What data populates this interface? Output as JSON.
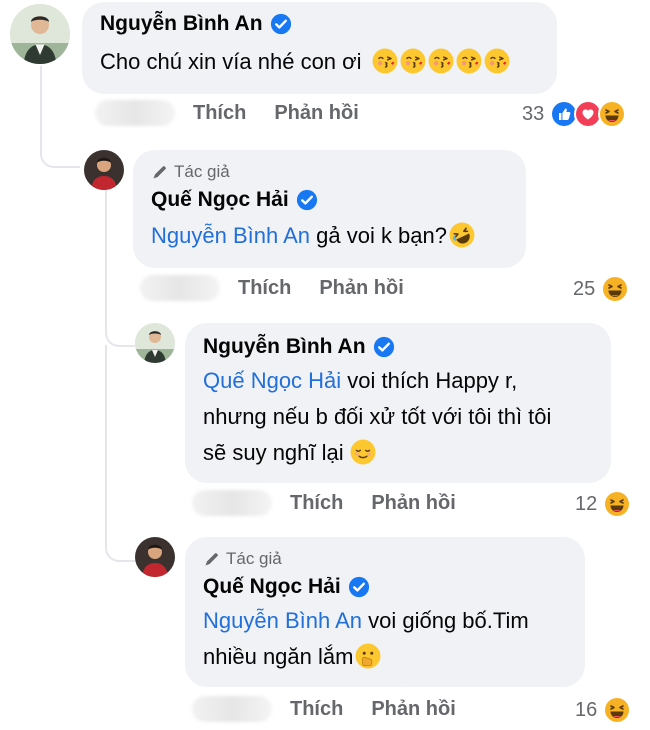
{
  "colors": {
    "bubble_bg": "#f0f2f5",
    "mention": "#216fdb",
    "verified": "#1877f2",
    "meta_text": "#65676b"
  },
  "comments": [
    {
      "name": "Nguyễn Bình An",
      "verified": true,
      "author_badge": "",
      "text": "Cho chú xin vía nhé con ơi",
      "emojis": [
        "kiss-face",
        "kiss-face",
        "kiss-face",
        "kiss-face",
        "kiss-face"
      ],
      "like_label": "Thích",
      "reply_label": "Phản hồi",
      "reaction_count": "33",
      "reactions": [
        "like",
        "love",
        "haha"
      ]
    },
    {
      "name": "Quế Ngọc Hải",
      "verified": true,
      "author_badge": "Tác giả",
      "mention": "Nguyễn Bình An",
      "text": " gả voi k bạn?",
      "emojis": [
        "rofl-face"
      ],
      "like_label": "Thích",
      "reply_label": "Phản hồi",
      "reaction_count": "25",
      "reactions": [
        "haha"
      ]
    },
    {
      "name": "Nguyễn Bình An",
      "verified": true,
      "mention": "Quế Ngọc Hải",
      "text_line1": " voi thích Happy r,",
      "text_line2": "nhưng nếu b đối xử tốt với tôi thì tôi",
      "text_line3": "sẽ suy nghĩ lại",
      "emojis": [
        "relieved-face"
      ],
      "like_label": "Thích",
      "reply_label": "Phản hồi",
      "reaction_count": "12",
      "reactions": [
        "haha"
      ]
    },
    {
      "name": "Quế Ngọc Hải",
      "verified": true,
      "author_badge": "Tác giả",
      "mention": "Nguyễn Bình An",
      "text_line1": " voi giống bố.Tim",
      "text_line2": "nhiều ngăn lắm",
      "emojis": [
        "hand-over-mouth-face"
      ],
      "like_label": "Thích",
      "reply_label": "Phản hồi",
      "reaction_count": "16",
      "reactions": [
        "haha"
      ]
    }
  ]
}
